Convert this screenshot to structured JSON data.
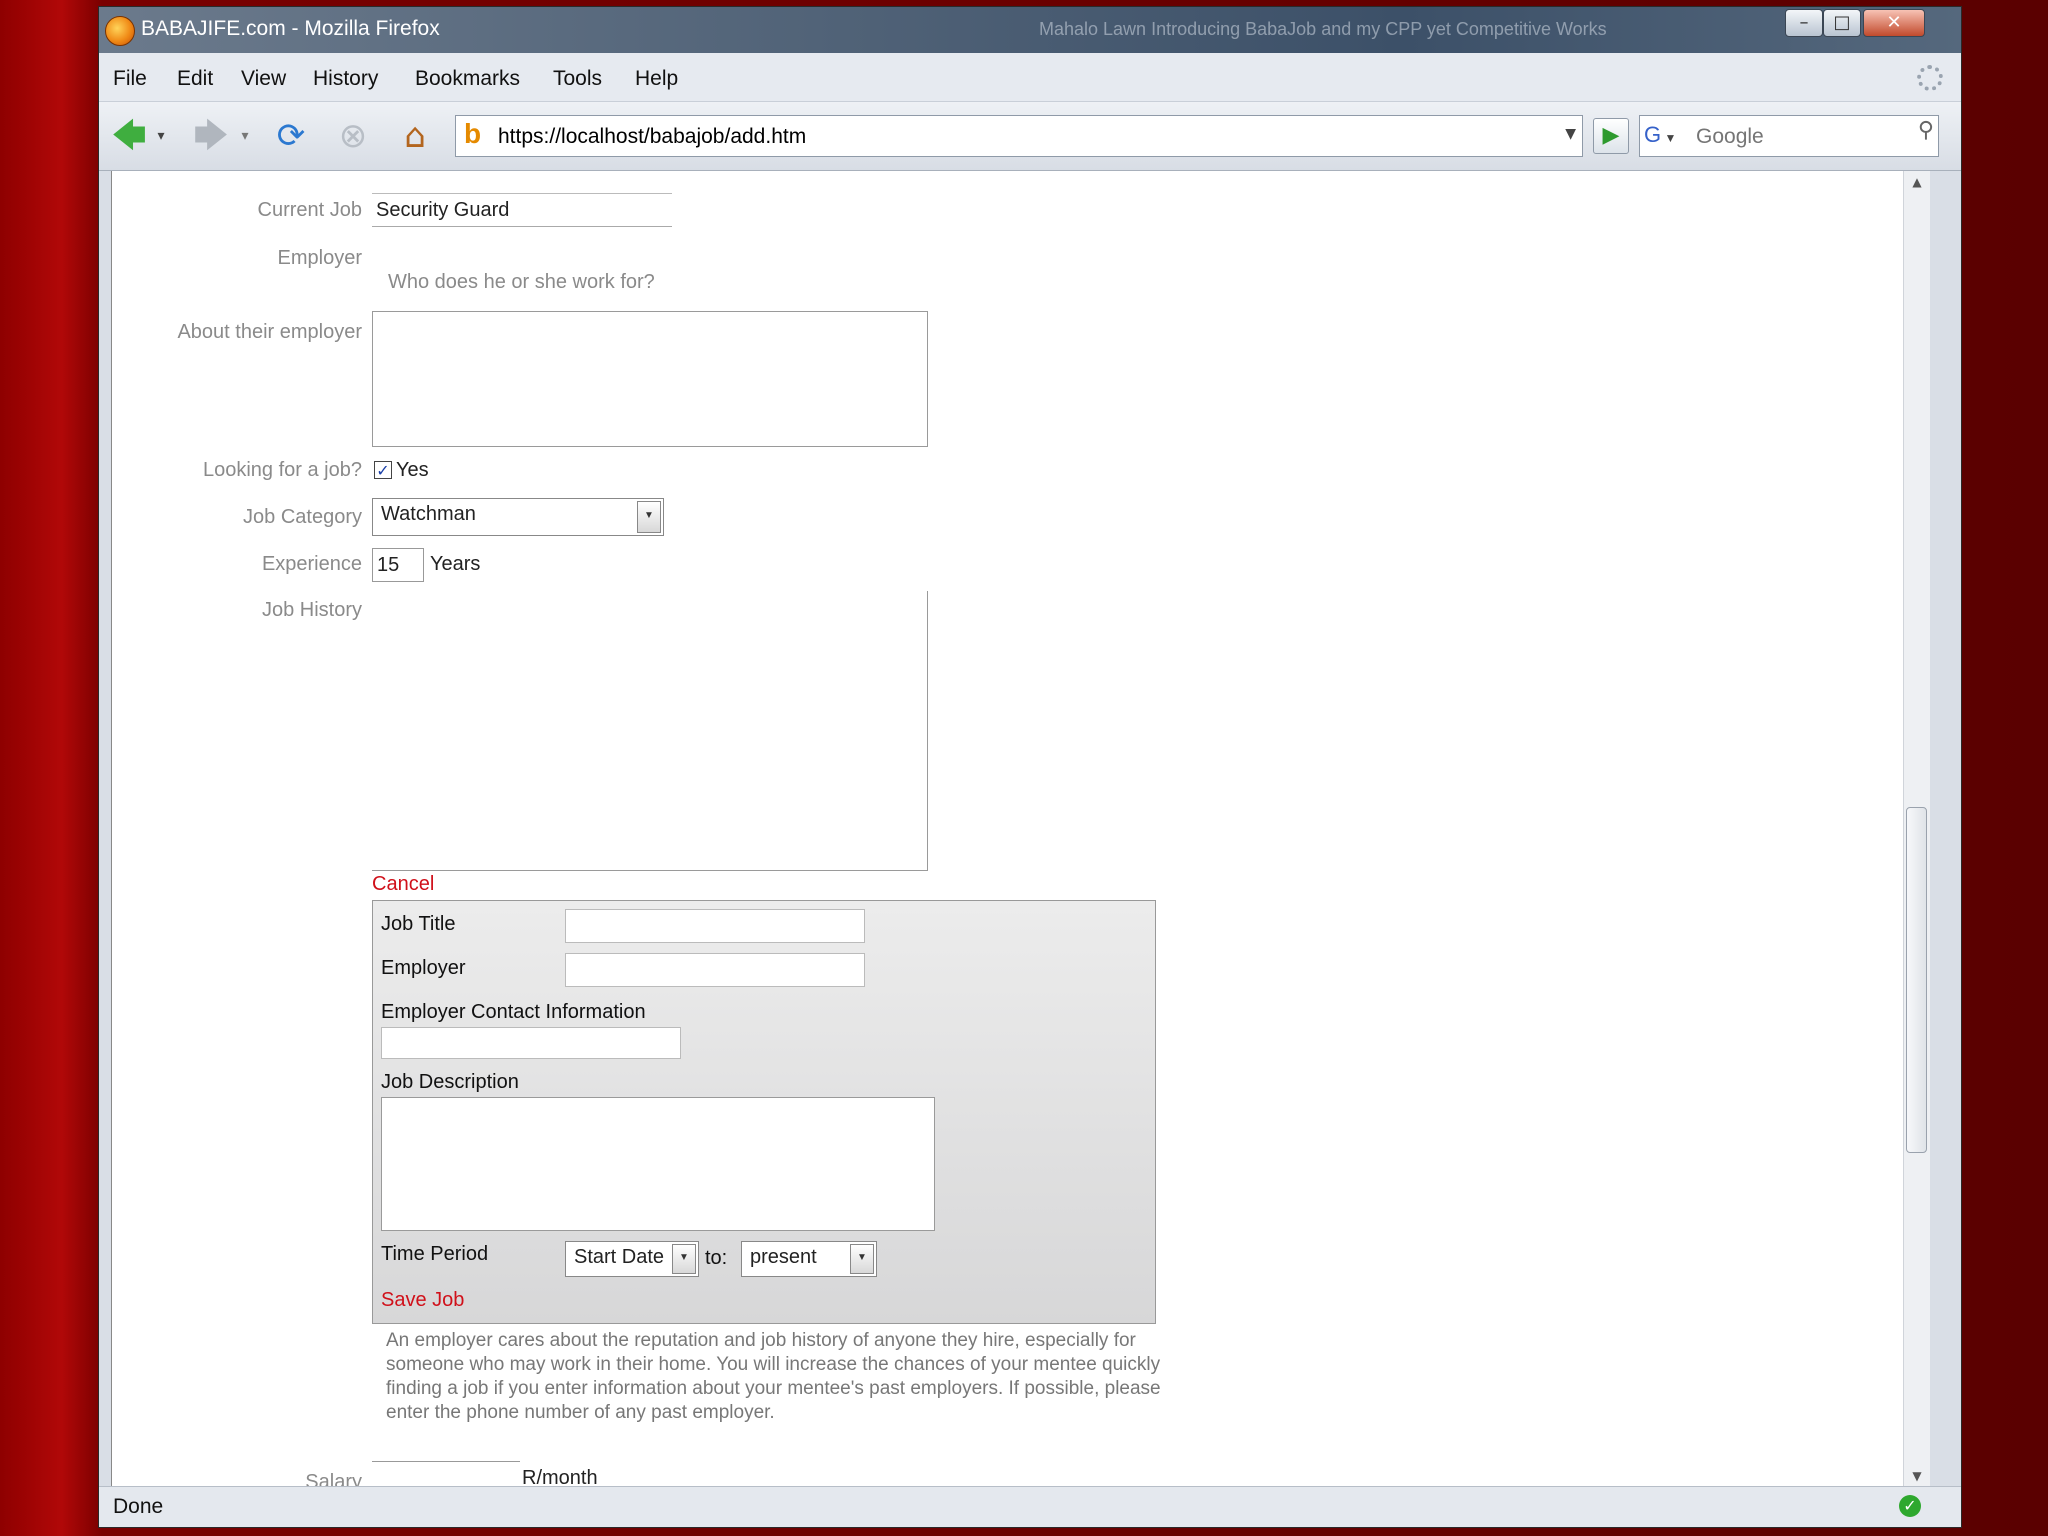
{
  "window": {
    "title": "BABAJIFE.com - Mozilla Firefox",
    "title_bar_tab": "Mahalo Lawn  Introducing BabaJob and my CPP yet Competitive Works"
  },
  "menu": [
    "File",
    "Edit",
    "View",
    "History",
    "Bookmarks",
    "Tools",
    "Help"
  ],
  "nav": {
    "url": "https://localhost/babajob/add.htm",
    "search_placeholder": "Google",
    "search_engine_letter": "G",
    "site_icon_letter": "b"
  },
  "form": {
    "current_job_label": "Current Job",
    "current_job_value": "Security Guard",
    "employer_label": "Employer",
    "employer_hint": "Who does he or she work for?",
    "about_employer_label": "About their employer",
    "looking_label": "Looking for a job?",
    "looking_option": "Yes",
    "job_category_label": "Job Category",
    "job_category_value": "Watchman",
    "experience_label": "Experience",
    "experience_value": "15",
    "experience_unit": "Years",
    "job_history_label": "Job History",
    "cancel_link": "Cancel",
    "salary_label": "Salary",
    "salary_unit": "R/month"
  },
  "job_panel": {
    "job_title_label": "Job Title",
    "employer_label": "Employer",
    "contact_label": "Employer Contact Information",
    "description_label": "Job Description",
    "time_period_label": "Time Period",
    "start_date_value": "Start Date",
    "to_label": "to:",
    "end_value": "present",
    "save_link": "Save Job"
  },
  "help_text": "An employer cares about the reputation and job history of anyone they hire, especially for someone who may work in their home. You will increase the chances of your mentee quickly finding a job if you enter information about your mentee's past employers. If possible, please enter the phone number of any past employer.",
  "status": {
    "text": "Done"
  }
}
